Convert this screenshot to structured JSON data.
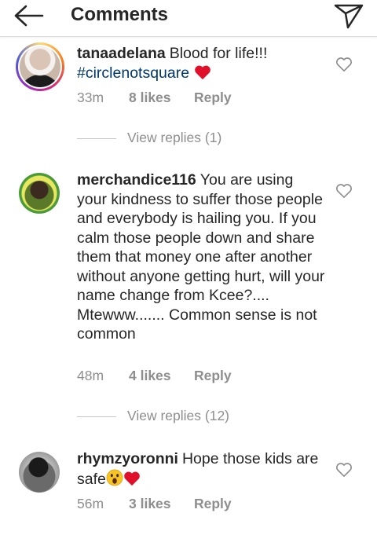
{
  "header": {
    "title": "Comments",
    "back_icon": "back-arrow-icon",
    "share_icon": "paper-plane-icon"
  },
  "comments": [
    {
      "username": "tanaadelana",
      "text": "Blood for life!!!",
      "hashtag": "#circlenotsquare",
      "emoji": "red-heart",
      "time": "33m",
      "likes": "8 likes",
      "reply": "Reply",
      "view_replies": "View replies (1)",
      "story_ring": true
    },
    {
      "username": "merchandice116",
      "text": "You are using your kindness to suffer those people and everybody is hailing you. If you calm those people down and share them that money one after another without anyone getting hurt, will your name change from Kcee?.... Mtewww....... Common sense is not common",
      "time": "48m",
      "likes": "4 likes",
      "reply": "Reply",
      "view_replies": "View replies (12)"
    },
    {
      "username": "rhymzyoronni",
      "text": "Hope those kids are safe",
      "emoji": "astonished-face red-heart",
      "time": "56m",
      "likes": "3 likes",
      "reply": "Reply"
    }
  ],
  "colors": {
    "text": "#262626",
    "meta": "#8e8e8e",
    "hashtag": "#00376b",
    "heart_red": "#e0102b"
  }
}
